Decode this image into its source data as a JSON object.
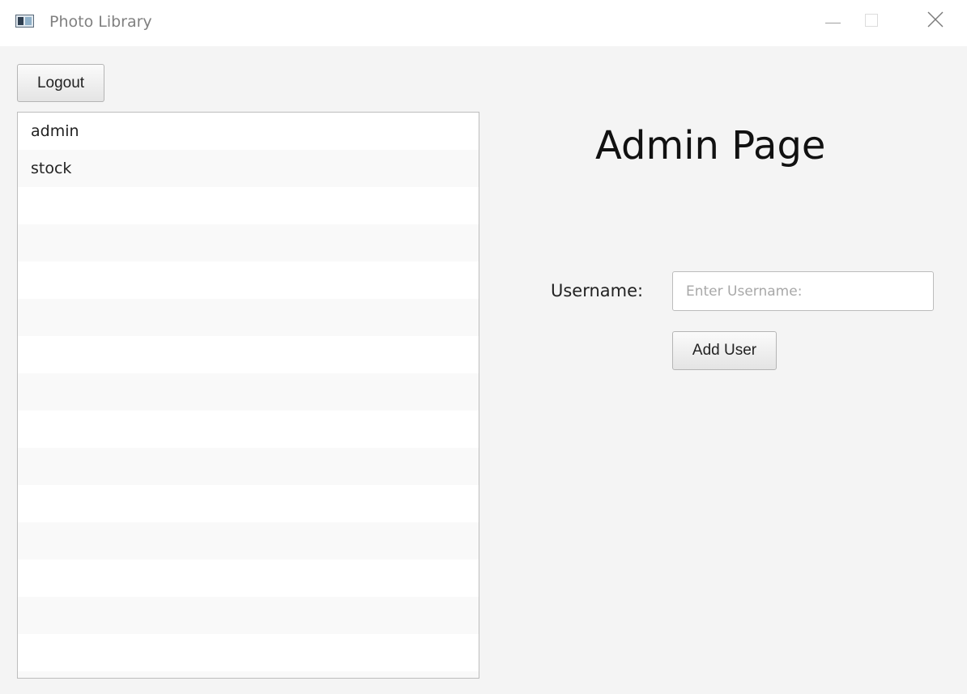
{
  "window": {
    "title": "Photo Library"
  },
  "toolbar": {
    "logout_label": "Logout"
  },
  "user_list": {
    "items": [
      "admin",
      "stock"
    ]
  },
  "main": {
    "title": "Admin Page",
    "username_label": "Username:",
    "username_value": "",
    "username_placeholder": "Enter Username:",
    "add_user_label": "Add User"
  },
  "icons": {
    "app": "app-window-icon",
    "minimize": "minimize-icon",
    "maximize": "maximize-icon",
    "close": "close-icon"
  }
}
